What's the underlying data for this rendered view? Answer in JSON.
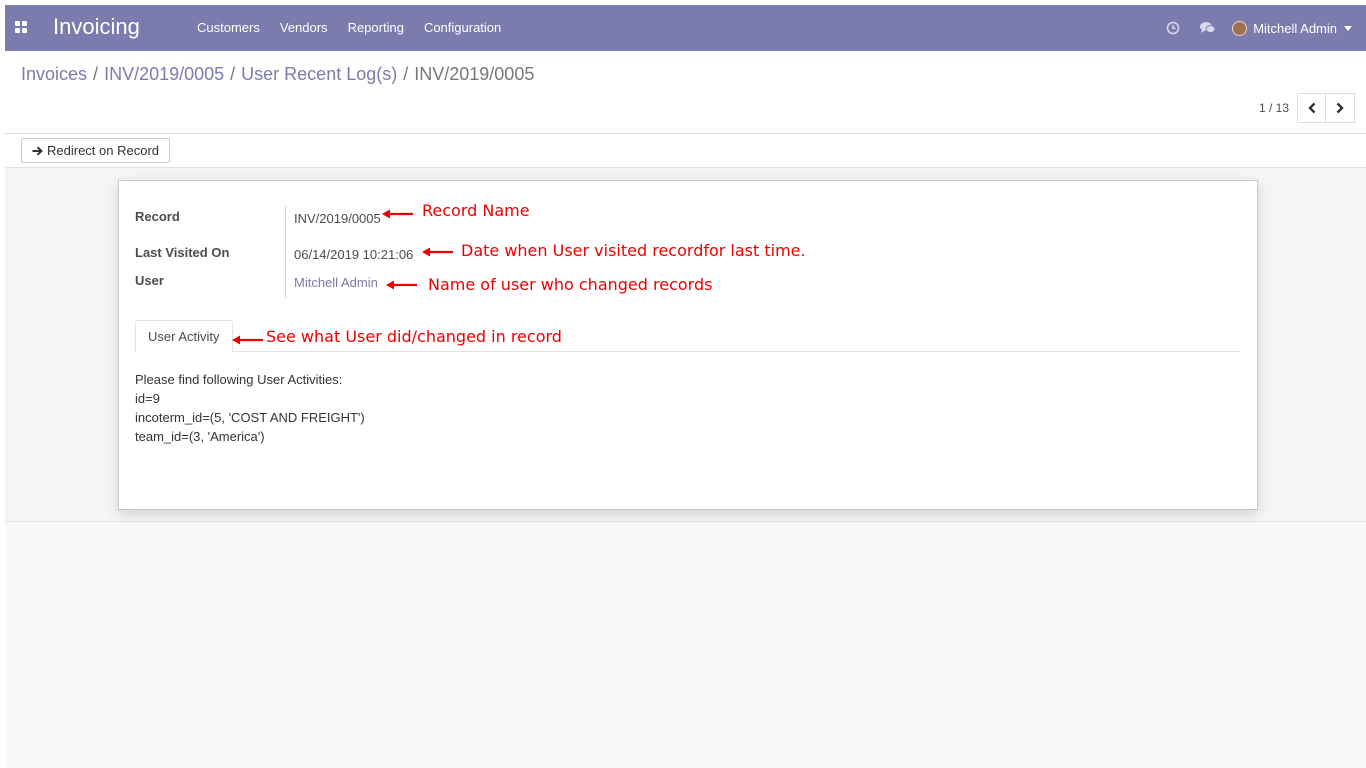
{
  "navbar": {
    "app_title": "Invoicing",
    "menu": [
      "Customers",
      "Vendors",
      "Reporting",
      "Configuration"
    ],
    "user_name": "Mitchell Admin",
    "colors": {
      "brand": "#7c7bad"
    }
  },
  "breadcrumb": {
    "items": [
      "Invoices",
      "INV/2019/0005",
      "User Recent Log(s)"
    ],
    "current": "INV/2019/0005",
    "separator": "/"
  },
  "pager": {
    "value": "1 / 13"
  },
  "actions": {
    "redirect_label": "Redirect on Record"
  },
  "form": {
    "record_label": "Record",
    "record_value": "INV/2019/0005",
    "last_visited_label": "Last Visited On",
    "last_visited_value": "06/14/2019 10:21:06",
    "user_label": "User",
    "user_value": "Mitchell Admin"
  },
  "tabs": {
    "user_activity": "User Activity"
  },
  "activity": {
    "heading": "Please find following User Activities:",
    "lines": [
      "id=9",
      "incoterm_id=(5, 'COST AND FREIGHT')",
      "team_id=(3, 'America')"
    ]
  },
  "annotations": {
    "record": "Record Name",
    "last_visited": "Date when User visited recordfor last time.",
    "user": "Name of user who changed records",
    "tab": "See what User did/changed in record",
    "color": "#ee0000"
  }
}
